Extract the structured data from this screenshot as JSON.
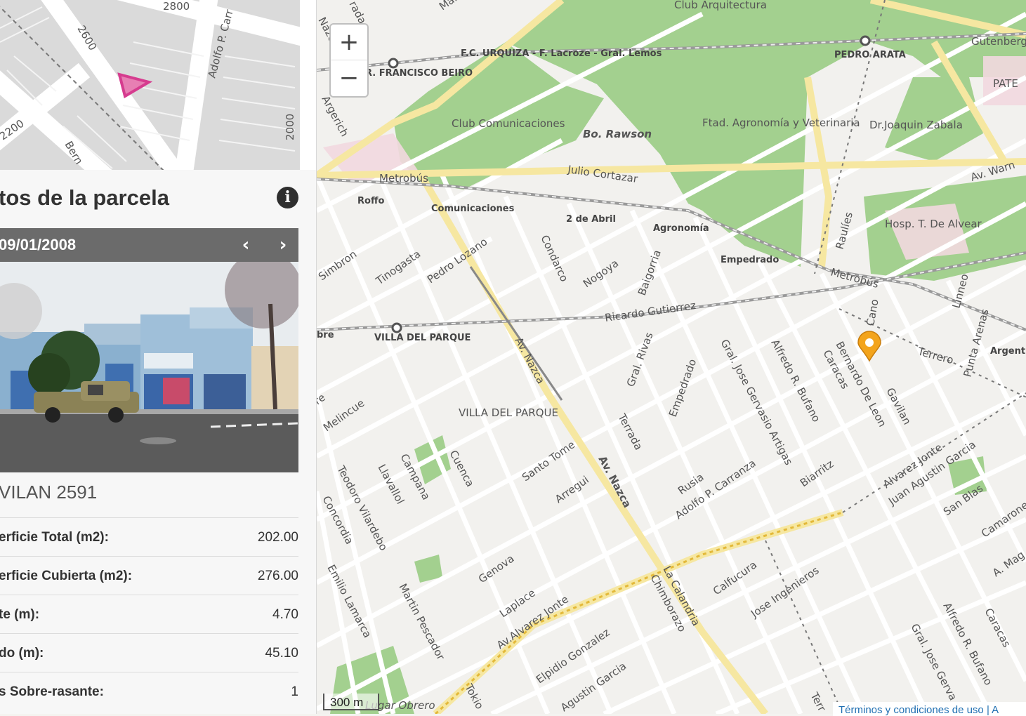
{
  "panel": {
    "title": "tos de la parcela",
    "photo_date": "09/01/2008",
    "address": "VILAN 2591",
    "details": [
      {
        "label": "erficie Total (m2):",
        "value": "202.00"
      },
      {
        "label": "erficie Cubierta (m2):",
        "value": "276.00"
      },
      {
        "label": "te (m):",
        "value": "4.70"
      },
      {
        "label": "do (m):",
        "value": "45.10"
      },
      {
        "label": "s Sobre-rasante:",
        "value": "1"
      }
    ]
  },
  "minimap": {
    "labels": [
      "2800",
      "2600",
      "2200",
      "2000",
      "Adolfo P. Carr",
      "Bern"
    ]
  },
  "map": {
    "zoom_in": "+",
    "zoom_out": "−",
    "scale": "300 m",
    "attribution": "Términos y condiciones de uso | A",
    "labels": {
      "railway_urquiza": "F.C. URQUIZA - F. Lacroze - Gral. Lemos",
      "francisco_beiro": "R. FRANCISCO BEIRO",
      "pedro_arata": "PEDRO ARATA",
      "club_arquitectura": "Club Arquitectura",
      "club_comunicaciones": "Club Comunicaciones",
      "bo_rawson": "Bo. Rawson",
      "ftad_agronomia": "Ftad. Agronomía y Veterinaria",
      "dr_joaquin_zabala": "Dr.Joaquin Zabala",
      "gutenberg": "Gutenberg",
      "pate": "PATE",
      "av_warnes": "Av. Warn",
      "julio_cortazar": "Julio Cortazar",
      "metrobus_1": "Metrobús",
      "metrobus_2": "Metrobús",
      "roffo": "Roffo",
      "comunicaciones": "Comunicaciones",
      "dos_de_abril": "2 de Abril",
      "agronomia": "Agronomía",
      "empedrado_1": "Empedrado",
      "hosp_alvear": "Hosp. T. De Alvear",
      "raulies": "Raulíes",
      "simbron": "Simbron",
      "tinogasta": "Tinogasta",
      "pedro_lozano": "Pedro Lozano",
      "condarco": "Condarco",
      "nogoya": "Nogoya",
      "baigorria": "Baigorria",
      "ricardo_gutierrez": "Ricardo Gutierrez",
      "villa_del_parque_station": "VILLA DEL PARQUE",
      "bre": "bre",
      "av_nazca_1": "Av. Nazca",
      "gral_rivas": "Gral. Rivas",
      "empedrado_2": "Empedrado",
      "gral_jose_gervasio_artigas": "Gral. Jose Gervasio Artigas",
      "alfredo_bufano": "Alfredo R. Bufano",
      "caracas": "Caracas",
      "bernardo_de_leon": "Bernardo De Leon",
      "cano": "Cano",
      "gavilan": "Gavilan",
      "terrero": "Terrero",
      "punta_arenas": "Punta Arenas",
      "linneo": "Linneo",
      "argentina": "Argentin",
      "villa_del_parque_area": "VILLA DEL PARQUE",
      "melincue": "Melincue",
      "re": "re",
      "terrada": "Terrada",
      "santo_tome": "Santo Tome",
      "av_nazca_2": "Av. Nazca",
      "rusia": "Rusia",
      "adolfo_p_carranza": "Adolfo P. Carranza",
      "biarritz": "Biarritz",
      "alvarez_jonte": "Alvarez Jonte",
      "juan_agustin_garcia_1": "Juan Agustin Garcia",
      "san_blas": "San Blas",
      "camarones": "Camarone",
      "a_magarinos": "A. Mag",
      "teodoro_vilardebo": "Teodoro Vilardebo",
      "lavallol": "Llavallol",
      "campana": "Campana",
      "cuenca": "Cuenca",
      "arregui": "Arregui",
      "concordia": "Concordia",
      "emilio_lamarca": "Emilio Lamarca",
      "martin_pescador": "Martin Pescador",
      "genova": "Genova",
      "laplace": "Laplace",
      "av_alvarez_jonte": "Av.Alvarez Jonte",
      "elpidio_gonzalez": "Elpidio Gonzalez",
      "agustin_garcia": "Agustin Garcia",
      "la_calandria": "La Calandria",
      "chimborazo": "Chimborazo",
      "calfucura": "Calfucura",
      "jose_ingenieros": "Jose Ingenieros",
      "alfredo_bufano_2": "Alfredo R. Bufano",
      "gral_jose_gerva": "Gral. Jose Gerva",
      "caracas_2": "Caracas",
      "tokio": "Tokio",
      "lugar_obrero": "Lugar Obrero",
      "argerich": "Argerich",
      "nazca_corner": "Nazca",
      "ternera": "Terr",
      "rada": "rada",
      "mar": "Mar"
    }
  },
  "colors": {
    "park_green": "#a3d08f",
    "map_background": "#f2f1ee",
    "road_yellow": "#f6e7a1",
    "marker_orange": "#f3a41c",
    "parcel_magenta": "#d63c8f",
    "panel_header": "#6b6b6b"
  },
  "icons": {
    "info": "info-icon",
    "prev": "chevron-left-icon",
    "next": "chevron-right-icon",
    "marker": "map-pin-icon"
  }
}
